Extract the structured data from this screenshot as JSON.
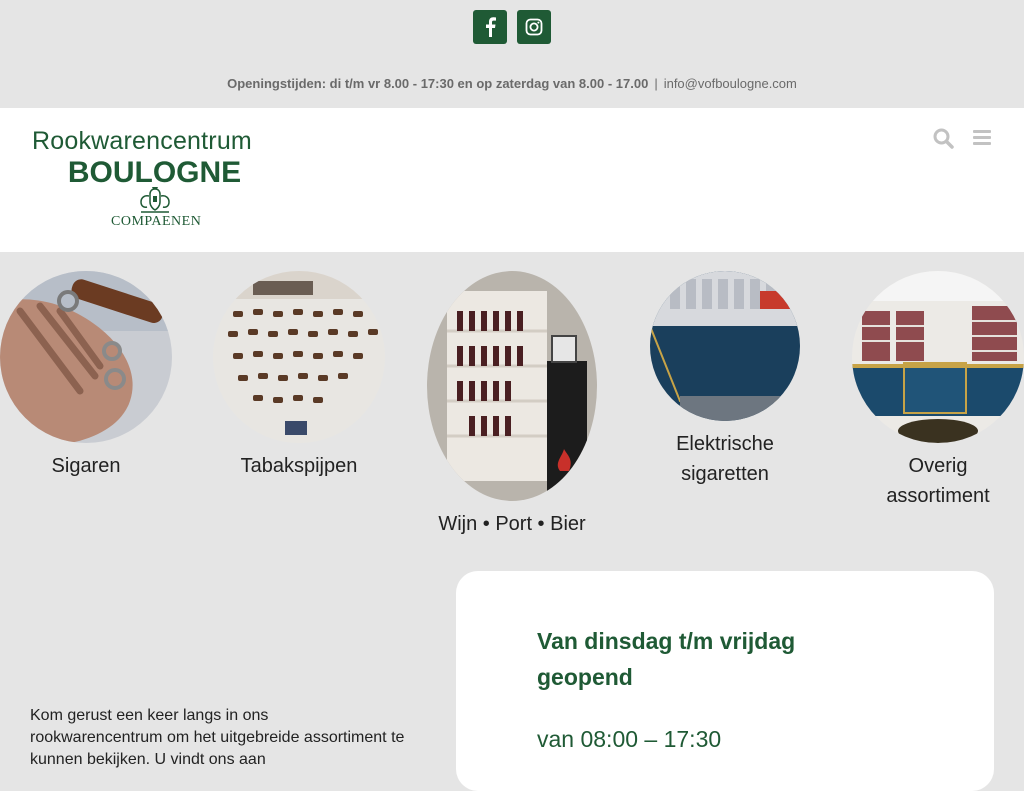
{
  "topbar": {
    "social": [
      {
        "name": "facebook"
      },
      {
        "name": "instagram"
      }
    ],
    "hours_label": "Openingstijden: di t/m vr 8.00 - 17:30 en op zaterdag van 8.00 - 17.00",
    "separator": "|",
    "email": "info@vofboulogne.com"
  },
  "header": {
    "logo_line1": "Rookwarencentrum",
    "logo_line2": "BOULOGNE",
    "logo_line3": "COMPAENEN",
    "icons": [
      "search-icon",
      "menu-icon"
    ]
  },
  "categories": [
    {
      "label": "Sigaren"
    },
    {
      "label": "Tabakspijpen"
    },
    {
      "label": "Wijn • Port • Bier"
    },
    {
      "label_line1": "Elektrische",
      "label_line2": "sigaretten"
    },
    {
      "label_line1": "Overig",
      "label_line2": "assortiment"
    }
  ],
  "hours_card": {
    "heading": "Van dinsdag t/m vrijdag geopend",
    "time": "van 08:00 – 17:30"
  },
  "intro": {
    "text": "Kom gerust een keer langs in ons rookwarencentrum om het uitgebreide assortiment te kunnen bekijken. U vindt ons aan"
  },
  "colors": {
    "brand_green": "#1f5a35",
    "background": "#e5e5e5"
  }
}
